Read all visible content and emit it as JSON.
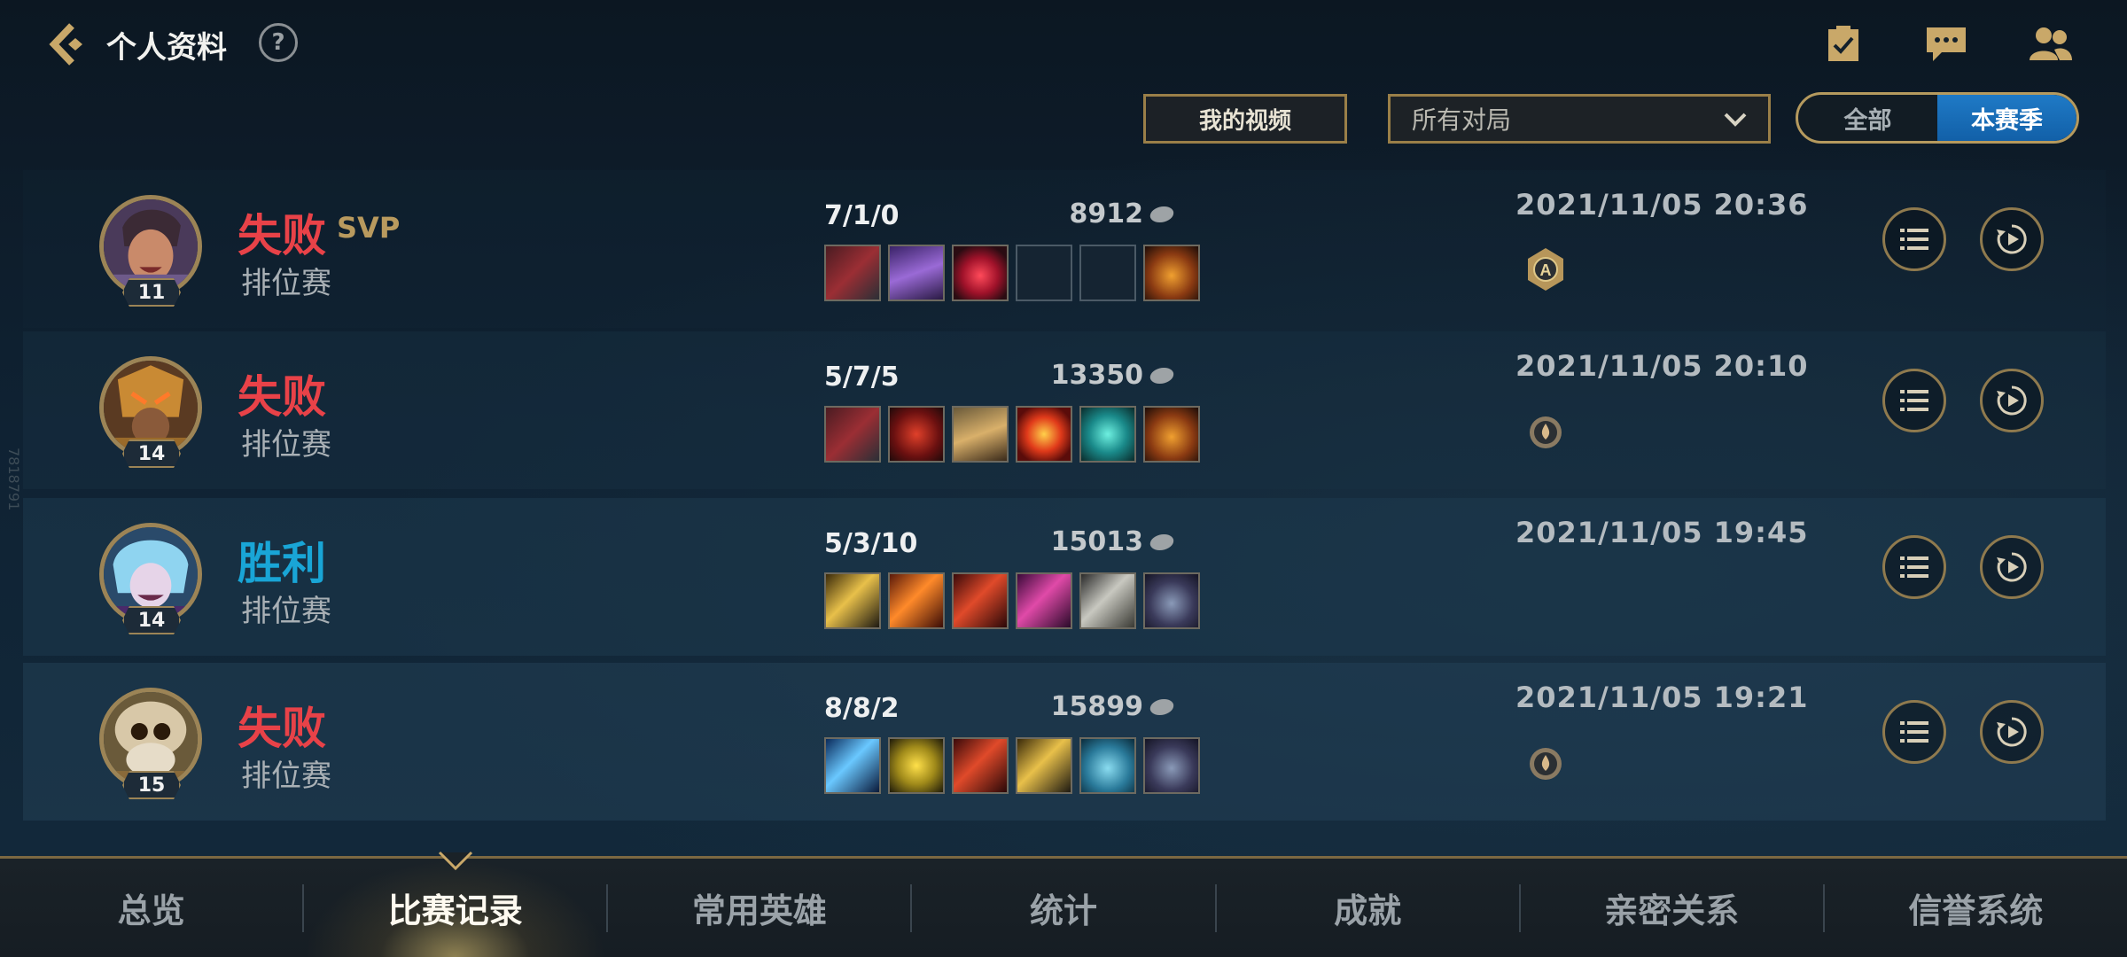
{
  "header": {
    "title": "个人资料",
    "help_label": "?"
  },
  "filters": {
    "video_button": "我的视频",
    "match_type": "所有对局",
    "season_options": [
      "全部",
      "本赛季"
    ],
    "season_selected": "本赛季"
  },
  "matches": [
    {
      "result": "失败",
      "result_type": "lose",
      "badge": "SVP",
      "mode": "排位赛",
      "level": "11",
      "kda": "7/1/0",
      "gold": "8912",
      "date": "2021/11/05 20:36",
      "items": [
        "blade-item-icon",
        "purple-armor-item-icon",
        "ruby-item-icon",
        "empty-slot",
        "empty-slot",
        "trinket-gold-item-icon"
      ]
    },
    {
      "result": "失败",
      "result_type": "lose",
      "badge": "",
      "mode": "排位赛",
      "level": "14",
      "kda": "5/7/5",
      "gold": "13350",
      "date": "2021/11/05 20:10",
      "items": [
        "blade-item-icon",
        "red-gauntlet-item-icon",
        "gold-armor-item-icon",
        "flame-orb-item-icon",
        "cyan-cloak-item-icon",
        "trinket-blue-item-icon"
      ]
    },
    {
      "result": "胜利",
      "result_type": "win",
      "badge": "",
      "mode": "排位赛",
      "level": "14",
      "kda": "5/3/10",
      "gold": "15013",
      "date": "2021/11/05 19:45",
      "items": [
        "gold-blade-item-icon",
        "fire-spear-item-icon",
        "crimson-blade-item-icon",
        "pink-crystal-item-icon",
        "silver-sword-item-icon",
        "serpent-item-icon"
      ]
    },
    {
      "result": "失败",
      "result_type": "lose",
      "badge": "",
      "mode": "排位赛",
      "level": "15",
      "kda": "8/8/2",
      "gold": "15899",
      "date": "2021/11/05 19:21",
      "items": [
        "ice-spear-item-icon",
        "yellow-shield-item-icon",
        "crimson-blade-item-icon",
        "gold-blade-item-icon",
        "scaled-egg-item-icon",
        "serpent-item-icon"
      ]
    }
  ],
  "side_text": "7818791",
  "nav": {
    "tabs": [
      "总览",
      "比赛记录",
      "常用英雄",
      "统计",
      "成就",
      "亲密关系",
      "信誉系统"
    ],
    "active": "比赛记录"
  },
  "colors": {
    "lose": "#e84248",
    "win": "#19a5d6",
    "gold_border": "#9a7f48",
    "toggle_active": "#1a6fb8"
  }
}
